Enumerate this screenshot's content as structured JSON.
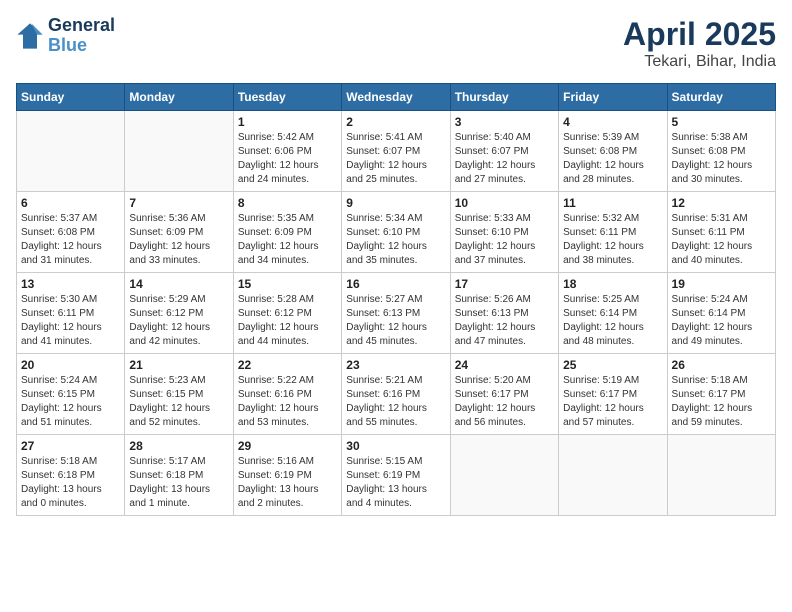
{
  "logo": {
    "line1": "General",
    "line2": "Blue"
  },
  "title": "April 2025",
  "location": "Tekari, Bihar, India",
  "days_of_week": [
    "Sunday",
    "Monday",
    "Tuesday",
    "Wednesday",
    "Thursday",
    "Friday",
    "Saturday"
  ],
  "weeks": [
    [
      {
        "day": "",
        "sunrise": "",
        "sunset": "",
        "daylight": ""
      },
      {
        "day": "",
        "sunrise": "",
        "sunset": "",
        "daylight": ""
      },
      {
        "day": "1",
        "sunrise": "Sunrise: 5:42 AM",
        "sunset": "Sunset: 6:06 PM",
        "daylight": "Daylight: 12 hours and 24 minutes."
      },
      {
        "day": "2",
        "sunrise": "Sunrise: 5:41 AM",
        "sunset": "Sunset: 6:07 PM",
        "daylight": "Daylight: 12 hours and 25 minutes."
      },
      {
        "day": "3",
        "sunrise": "Sunrise: 5:40 AM",
        "sunset": "Sunset: 6:07 PM",
        "daylight": "Daylight: 12 hours and 27 minutes."
      },
      {
        "day": "4",
        "sunrise": "Sunrise: 5:39 AM",
        "sunset": "Sunset: 6:08 PM",
        "daylight": "Daylight: 12 hours and 28 minutes."
      },
      {
        "day": "5",
        "sunrise": "Sunrise: 5:38 AM",
        "sunset": "Sunset: 6:08 PM",
        "daylight": "Daylight: 12 hours and 30 minutes."
      }
    ],
    [
      {
        "day": "6",
        "sunrise": "Sunrise: 5:37 AM",
        "sunset": "Sunset: 6:08 PM",
        "daylight": "Daylight: 12 hours and 31 minutes."
      },
      {
        "day": "7",
        "sunrise": "Sunrise: 5:36 AM",
        "sunset": "Sunset: 6:09 PM",
        "daylight": "Daylight: 12 hours and 33 minutes."
      },
      {
        "day": "8",
        "sunrise": "Sunrise: 5:35 AM",
        "sunset": "Sunset: 6:09 PM",
        "daylight": "Daylight: 12 hours and 34 minutes."
      },
      {
        "day": "9",
        "sunrise": "Sunrise: 5:34 AM",
        "sunset": "Sunset: 6:10 PM",
        "daylight": "Daylight: 12 hours and 35 minutes."
      },
      {
        "day": "10",
        "sunrise": "Sunrise: 5:33 AM",
        "sunset": "Sunset: 6:10 PM",
        "daylight": "Daylight: 12 hours and 37 minutes."
      },
      {
        "day": "11",
        "sunrise": "Sunrise: 5:32 AM",
        "sunset": "Sunset: 6:11 PM",
        "daylight": "Daylight: 12 hours and 38 minutes."
      },
      {
        "day": "12",
        "sunrise": "Sunrise: 5:31 AM",
        "sunset": "Sunset: 6:11 PM",
        "daylight": "Daylight: 12 hours and 40 minutes."
      }
    ],
    [
      {
        "day": "13",
        "sunrise": "Sunrise: 5:30 AM",
        "sunset": "Sunset: 6:11 PM",
        "daylight": "Daylight: 12 hours and 41 minutes."
      },
      {
        "day": "14",
        "sunrise": "Sunrise: 5:29 AM",
        "sunset": "Sunset: 6:12 PM",
        "daylight": "Daylight: 12 hours and 42 minutes."
      },
      {
        "day": "15",
        "sunrise": "Sunrise: 5:28 AM",
        "sunset": "Sunset: 6:12 PM",
        "daylight": "Daylight: 12 hours and 44 minutes."
      },
      {
        "day": "16",
        "sunrise": "Sunrise: 5:27 AM",
        "sunset": "Sunset: 6:13 PM",
        "daylight": "Daylight: 12 hours and 45 minutes."
      },
      {
        "day": "17",
        "sunrise": "Sunrise: 5:26 AM",
        "sunset": "Sunset: 6:13 PM",
        "daylight": "Daylight: 12 hours and 47 minutes."
      },
      {
        "day": "18",
        "sunrise": "Sunrise: 5:25 AM",
        "sunset": "Sunset: 6:14 PM",
        "daylight": "Daylight: 12 hours and 48 minutes."
      },
      {
        "day": "19",
        "sunrise": "Sunrise: 5:24 AM",
        "sunset": "Sunset: 6:14 PM",
        "daylight": "Daylight: 12 hours and 49 minutes."
      }
    ],
    [
      {
        "day": "20",
        "sunrise": "Sunrise: 5:24 AM",
        "sunset": "Sunset: 6:15 PM",
        "daylight": "Daylight: 12 hours and 51 minutes."
      },
      {
        "day": "21",
        "sunrise": "Sunrise: 5:23 AM",
        "sunset": "Sunset: 6:15 PM",
        "daylight": "Daylight: 12 hours and 52 minutes."
      },
      {
        "day": "22",
        "sunrise": "Sunrise: 5:22 AM",
        "sunset": "Sunset: 6:16 PM",
        "daylight": "Daylight: 12 hours and 53 minutes."
      },
      {
        "day": "23",
        "sunrise": "Sunrise: 5:21 AM",
        "sunset": "Sunset: 6:16 PM",
        "daylight": "Daylight: 12 hours and 55 minutes."
      },
      {
        "day": "24",
        "sunrise": "Sunrise: 5:20 AM",
        "sunset": "Sunset: 6:17 PM",
        "daylight": "Daylight: 12 hours and 56 minutes."
      },
      {
        "day": "25",
        "sunrise": "Sunrise: 5:19 AM",
        "sunset": "Sunset: 6:17 PM",
        "daylight": "Daylight: 12 hours and 57 minutes."
      },
      {
        "day": "26",
        "sunrise": "Sunrise: 5:18 AM",
        "sunset": "Sunset: 6:17 PM",
        "daylight": "Daylight: 12 hours and 59 minutes."
      }
    ],
    [
      {
        "day": "27",
        "sunrise": "Sunrise: 5:18 AM",
        "sunset": "Sunset: 6:18 PM",
        "daylight": "Daylight: 13 hours and 0 minutes."
      },
      {
        "day": "28",
        "sunrise": "Sunrise: 5:17 AM",
        "sunset": "Sunset: 6:18 PM",
        "daylight": "Daylight: 13 hours and 1 minute."
      },
      {
        "day": "29",
        "sunrise": "Sunrise: 5:16 AM",
        "sunset": "Sunset: 6:19 PM",
        "daylight": "Daylight: 13 hours and 2 minutes."
      },
      {
        "day": "30",
        "sunrise": "Sunrise: 5:15 AM",
        "sunset": "Sunset: 6:19 PM",
        "daylight": "Daylight: 13 hours and 4 minutes."
      },
      {
        "day": "",
        "sunrise": "",
        "sunset": "",
        "daylight": ""
      },
      {
        "day": "",
        "sunrise": "",
        "sunset": "",
        "daylight": ""
      },
      {
        "day": "",
        "sunrise": "",
        "sunset": "",
        "daylight": ""
      }
    ]
  ]
}
